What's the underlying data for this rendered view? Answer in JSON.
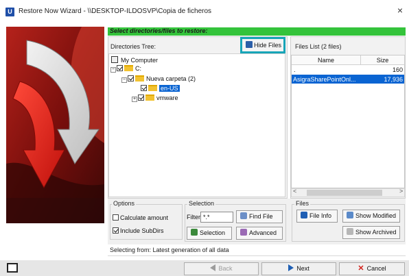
{
  "window": {
    "app_icon_letter": "U",
    "title": "Restore Now Wizard - \\\\DESKTOP-ILDOSVP\\Copia de ficheros",
    "close_glyph": "×"
  },
  "header": {
    "prompt": "Select directories/files to restore:",
    "accent_color": "#34c33b"
  },
  "directories": {
    "label": "Directories Tree:",
    "hide_files_label": "Hide Files",
    "tree": {
      "root": "My Computer",
      "drive": "C:",
      "folder": "Nueva carpeta (2)",
      "child_selected": "en-US",
      "child_other": "vmware"
    }
  },
  "files": {
    "label": "Files List (2 files)",
    "columns": [
      "Name",
      "Size"
    ],
    "rows": [
      {
        "name": ".",
        "size": "160"
      },
      {
        "name": "AsigraSharePointOnl...",
        "size": "17,936"
      }
    ]
  },
  "options": {
    "title": "Options",
    "calculate_amount": "Calculate amount",
    "include_subdirs": "Include SubDirs"
  },
  "selection": {
    "title": "Selection",
    "filter_label": "Filter:",
    "filter_value": "*.*",
    "find_file": "Find File",
    "selection_btn": "Selection",
    "advanced_btn": "Advanced"
  },
  "files_group": {
    "title": "Files",
    "file_info": "File Info",
    "show_modified": "Show Modified",
    "show_archived": "Show Archived"
  },
  "status": "Selecting from: Latest generation of all data",
  "nav": {
    "back": "Back",
    "next": "Next",
    "cancel": "Cancel"
  }
}
